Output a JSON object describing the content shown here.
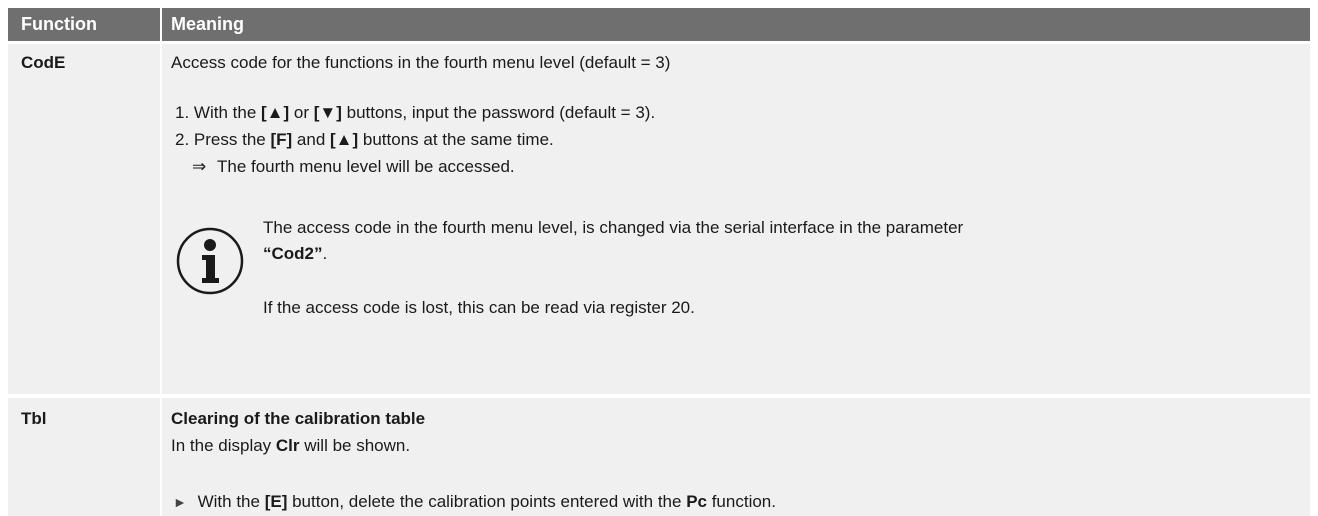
{
  "header": {
    "col_function": "Function",
    "col_meaning": "Meaning"
  },
  "rows": [
    {
      "function": "CodE",
      "intro": "Access code for the functions in the fourth menu level (default = 3)",
      "step1": {
        "num": "1.",
        "pre": "With the ",
        "key_up": "[▲]",
        "or": " or ",
        "key_down": "[▼]",
        "post": " buttons, input the password (default = 3)."
      },
      "step2": {
        "num": "2.",
        "pre": "Press the ",
        "key_f": "[F]",
        "and": " and ",
        "key_up": "[▲]",
        "post": " buttons at the same time."
      },
      "result": {
        "arrow": "⇒",
        "text": "The fourth menu level will be accessed."
      },
      "info_icon": "information-icon",
      "note_line1": "The access code in the fourth menu level, is changed via the serial interface in the parameter",
      "note_param": "“Cod2”",
      "note_param_end": ".",
      "note_line3": "If the access code is lost, this can be read via register 20."
    },
    {
      "function": "Tbl",
      "heading": "Clearing of the calibration table",
      "display_pre": "In the display ",
      "display_val": "Clr",
      "display_post": " will be shown.",
      "action": {
        "bullet": "►",
        "pre": "With the ",
        "key": "[E]",
        "mid": " button, delete the calibration points entered with the ",
        "fn": "Pc",
        "post": " function."
      }
    }
  ]
}
